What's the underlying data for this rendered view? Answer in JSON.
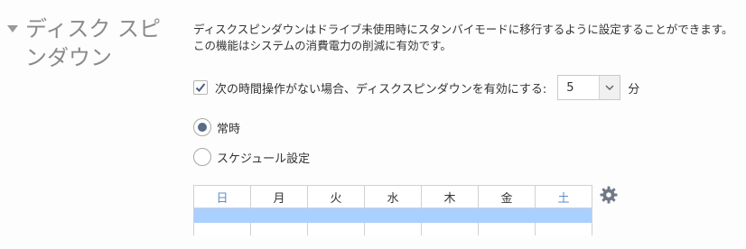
{
  "section": {
    "title": "ディスク スピンダウン"
  },
  "description": {
    "line1": "ディスクスピンダウンはドライブ未使用時にスタンバイモードに移行するように設定することができます。",
    "line2": "この機能はシステムの消費電力の削減に有効です。"
  },
  "spindown": {
    "checked": true,
    "label": "次の時間操作がない場合、ディスクスピンダウンを有効にする:",
    "value": "5",
    "unit": "分"
  },
  "mode": {
    "options": [
      {
        "label": "常時",
        "selected": true
      },
      {
        "label": "スケジュール設定",
        "selected": false
      }
    ]
  },
  "schedule": {
    "days": [
      "日",
      "月",
      "火",
      "水",
      "木",
      "金",
      "土"
    ],
    "weekend_color": "#5a8fc4",
    "bar_color": "#a9d0ff"
  },
  "icons": {
    "settings": "gear-icon",
    "collapse": "caret-down-icon"
  }
}
